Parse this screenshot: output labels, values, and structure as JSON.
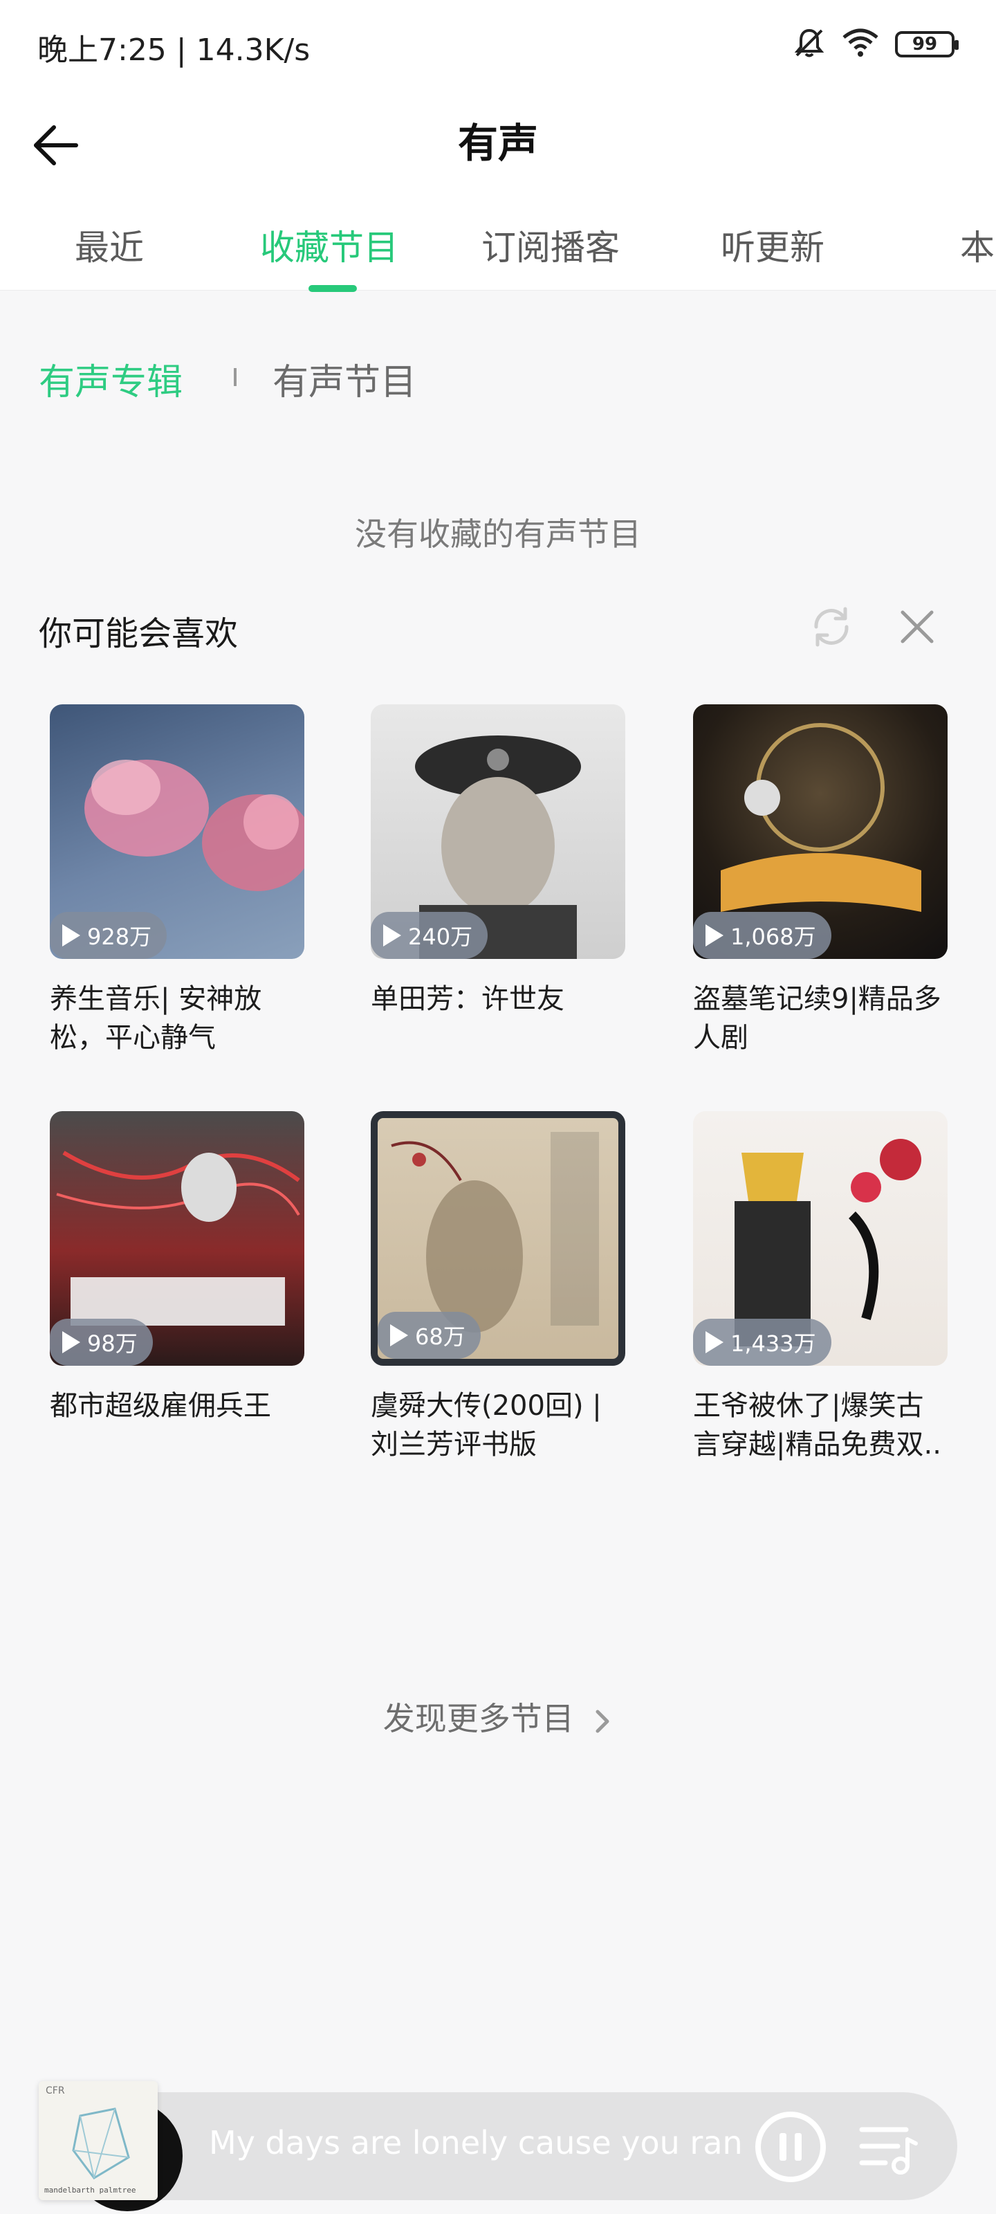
{
  "status_bar": {
    "time_speed": "晚上7:25 | 14.3K/s",
    "battery": "99",
    "icons": [
      "mute-bell-icon",
      "wifi-icon",
      "battery-icon"
    ]
  },
  "header": {
    "title": "有声",
    "back_icon": "arrow-left-icon"
  },
  "tabs": [
    {
      "label": "最近",
      "active": false
    },
    {
      "label": "收藏节目",
      "active": true
    },
    {
      "label": "订阅播客",
      "active": false
    },
    {
      "label": "听更新",
      "active": false
    },
    {
      "label": "本",
      "active": false
    }
  ],
  "segments": {
    "albums": "有声专辑",
    "programs": "有声节目"
  },
  "empty_message": "没有收藏的有声节目",
  "recommend": {
    "title": "你可能会喜欢",
    "refresh_icon": "refresh-icon",
    "close_icon": "close-icon",
    "items": [
      {
        "title": "养生音乐| 安神放松，平心静气",
        "plays": "928万"
      },
      {
        "title": "单田芳：许世友",
        "plays": "240万"
      },
      {
        "title": "盗墓笔记续9|精品多人剧",
        "plays": "1,068万"
      },
      {
        "title": "都市超级雇佣兵王",
        "plays": "98万"
      },
      {
        "title": "虞舜大传(200回) | 刘兰芳评书版",
        "plays": "68万"
      },
      {
        "title": "王爷被休了|爆笑古言穿越|精品免费双..",
        "plays": "1,433万"
      }
    ]
  },
  "more_link": "发现更多节目",
  "player": {
    "now_playing": "My days are lonely cause you ran",
    "art_text_top": "CFR",
    "art_text_bottom": "mandelbarth palmtree"
  },
  "colors": {
    "accent": "#27c97a",
    "background": "#f7f7f8",
    "player_bar": "#e2e2e3"
  }
}
